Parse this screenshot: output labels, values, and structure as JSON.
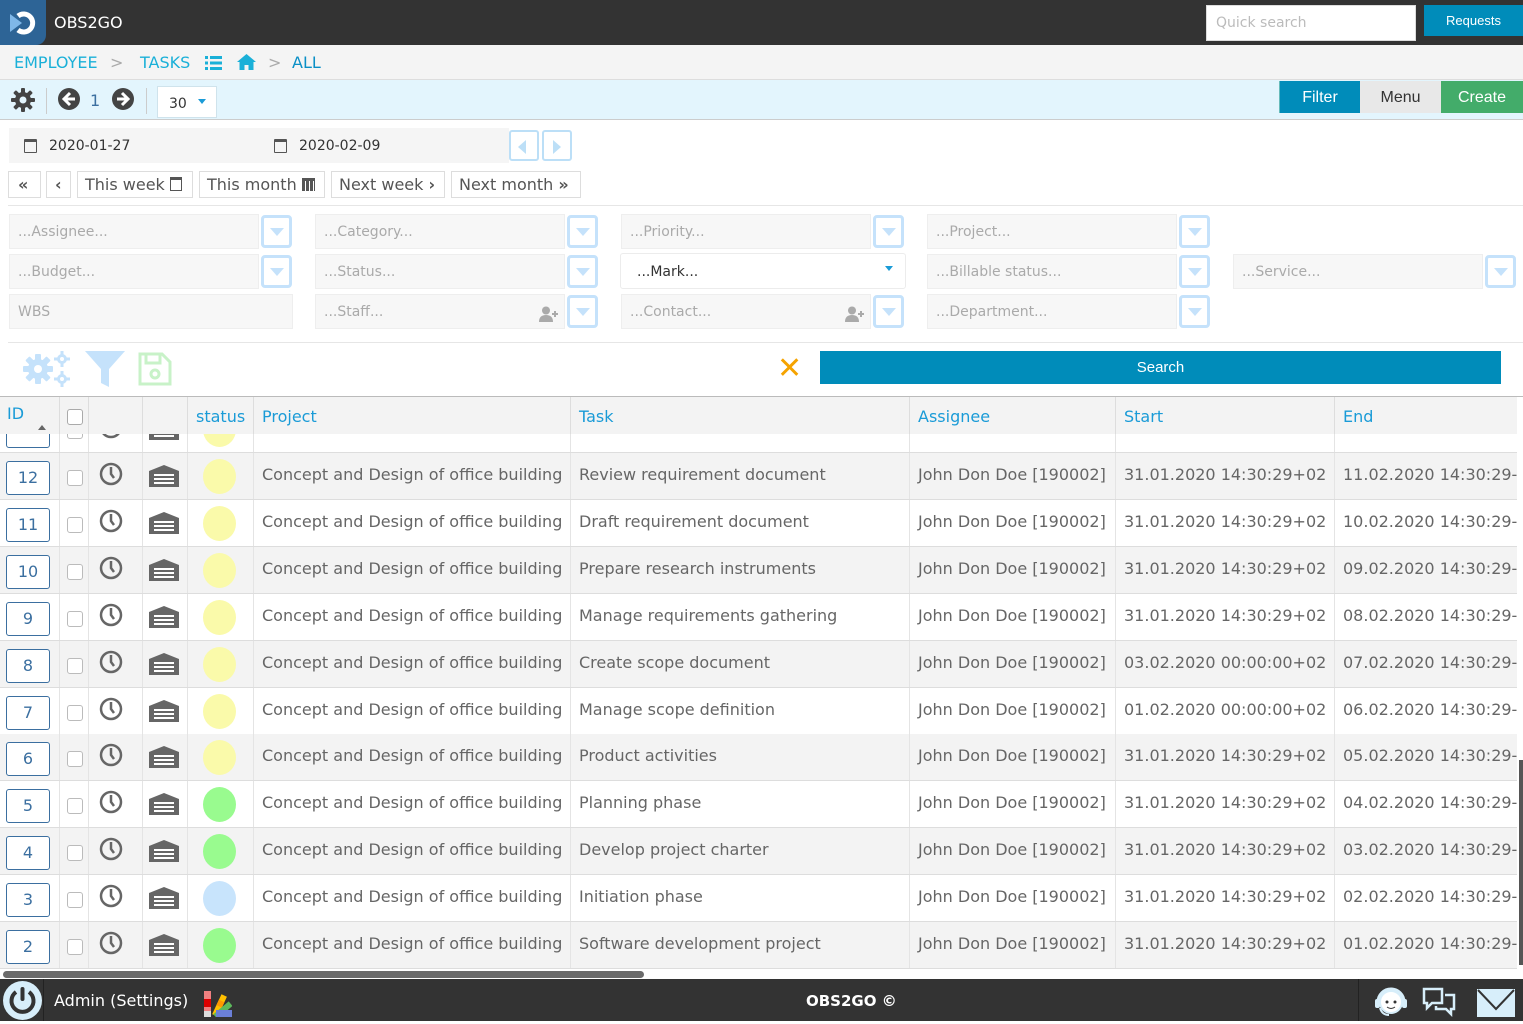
{
  "app": {
    "title": "OBS2GO",
    "quick_search_placeholder": "Quick search",
    "requests_label": "Requests"
  },
  "breadcrumb": {
    "items": [
      "EMPLOYEE",
      "TASKS",
      "ALL"
    ],
    "separator": ">"
  },
  "toolbar": {
    "page": "1",
    "page_size": "30",
    "filter_label": "Filter",
    "menu_label": "Menu",
    "create_label": "Create"
  },
  "dates": {
    "from": "2020-01-27",
    "to": "2020-02-09"
  },
  "range_buttons": {
    "this_week": "This week",
    "this_month": "This month",
    "next_week": "Next week",
    "next_month": "Next month"
  },
  "filters": {
    "assignee": "...Assignee...",
    "category": "...Category...",
    "priority": "...Priority...",
    "project": "...Project...",
    "budget": "...Budget...",
    "status": "...Status...",
    "mark": "...Mark...",
    "billable_status": "...Billable status...",
    "service": "...Service...",
    "wbs": "WBS",
    "staff": "...Staff...",
    "contact": "...Contact...",
    "department": "...Department..."
  },
  "search_label": "Search",
  "colors": {
    "primary": "#008cba",
    "success": "#43ac6a",
    "status_yellow": "#fafaaa",
    "status_green": "#99fb8f",
    "status_blue": "#c8e4fc",
    "clear_orange": "#f5a300"
  },
  "table": {
    "columns": [
      "ID",
      "status",
      "Project",
      "Task",
      "Assignee",
      "Start",
      "End"
    ],
    "rows": [
      {
        "id": "12",
        "status": "yellow",
        "project": "Concept and Design of office building",
        "task": "Review requirement document",
        "assignee": "John Don Doe [190002]",
        "start": "31.01.2020 14:30:29+02",
        "end": "11.02.2020 14:30:29-"
      },
      {
        "id": "11",
        "status": "yellow",
        "project": "Concept and Design of office building",
        "task": "Draft requirement document",
        "assignee": "John Don Doe [190002]",
        "start": "31.01.2020 14:30:29+02",
        "end": "10.02.2020 14:30:29-"
      },
      {
        "id": "10",
        "status": "yellow",
        "project": "Concept and Design of office building",
        "task": "Prepare research instruments",
        "assignee": "John Don Doe [190002]",
        "start": "31.01.2020 14:30:29+02",
        "end": "09.02.2020 14:30:29-"
      },
      {
        "id": "9",
        "status": "yellow",
        "project": "Concept and Design of office building",
        "task": "Manage requirements gathering",
        "assignee": "John Don Doe [190002]",
        "start": "31.01.2020 14:30:29+02",
        "end": "08.02.2020 14:30:29-"
      },
      {
        "id": "8",
        "status": "yellow",
        "project": "Concept and Design of office building",
        "task": "Create scope document",
        "assignee": "John Don Doe [190002]",
        "start": "03.02.2020 00:00:00+02",
        "end": "07.02.2020 14:30:29-"
      },
      {
        "id": "7",
        "status": "yellow",
        "project": "Concept and Design of office building",
        "task": "Manage scope definition",
        "assignee": "John Don Doe [190002]",
        "start": "01.02.2020 00:00:00+02",
        "end": "06.02.2020 14:30:29-"
      },
      {
        "id": "6",
        "status": "yellow",
        "project": "Concept and Design of office building",
        "task": "Product activities",
        "assignee": "John Don Doe [190002]",
        "start": "31.01.2020 14:30:29+02",
        "end": "05.02.2020 14:30:29-"
      },
      {
        "id": "5",
        "status": "green",
        "project": "Concept and Design of office building",
        "task": "Planning phase",
        "assignee": "John Don Doe [190002]",
        "start": "31.01.2020 14:30:29+02",
        "end": "04.02.2020 14:30:29-"
      },
      {
        "id": "4",
        "status": "green",
        "project": "Concept and Design of office building",
        "task": "Develop project charter",
        "assignee": "John Don Doe [190002]",
        "start": "31.01.2020 14:30:29+02",
        "end": "03.02.2020 14:30:29-"
      },
      {
        "id": "3",
        "status": "blue",
        "project": "Concept and Design of office building",
        "task": "Initiation phase",
        "assignee": "John Don Doe [190002]",
        "start": "31.01.2020 14:30:29+02",
        "end": "02.02.2020 14:30:29-"
      },
      {
        "id": "2",
        "status": "green",
        "project": "Concept and Design of office building",
        "task": "Software development project",
        "assignee": "John Don Doe [190002]",
        "start": "31.01.2020 14:30:29+02",
        "end": "01.02.2020 14:30:29-"
      }
    ]
  },
  "footer": {
    "user_label": "Admin (Settings)",
    "copyright": "OBS2GO ©"
  }
}
